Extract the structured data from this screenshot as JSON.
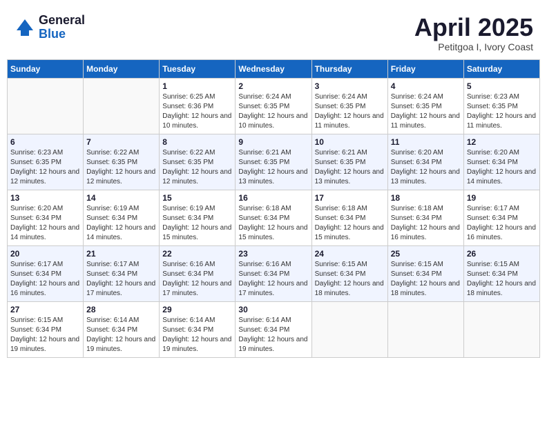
{
  "header": {
    "logo_general": "General",
    "logo_blue": "Blue",
    "month_title": "April 2025",
    "location": "Petitgoa I, Ivory Coast"
  },
  "weekdays": [
    "Sunday",
    "Monday",
    "Tuesday",
    "Wednesday",
    "Thursday",
    "Friday",
    "Saturday"
  ],
  "weeks": [
    [
      {
        "day": "",
        "sunrise": "",
        "sunset": "",
        "daylight": ""
      },
      {
        "day": "",
        "sunrise": "",
        "sunset": "",
        "daylight": ""
      },
      {
        "day": "1",
        "sunrise": "Sunrise: 6:25 AM",
        "sunset": "Sunset: 6:36 PM",
        "daylight": "Daylight: 12 hours and 10 minutes."
      },
      {
        "day": "2",
        "sunrise": "Sunrise: 6:24 AM",
        "sunset": "Sunset: 6:35 PM",
        "daylight": "Daylight: 12 hours and 10 minutes."
      },
      {
        "day": "3",
        "sunrise": "Sunrise: 6:24 AM",
        "sunset": "Sunset: 6:35 PM",
        "daylight": "Daylight: 12 hours and 11 minutes."
      },
      {
        "day": "4",
        "sunrise": "Sunrise: 6:24 AM",
        "sunset": "Sunset: 6:35 PM",
        "daylight": "Daylight: 12 hours and 11 minutes."
      },
      {
        "day": "5",
        "sunrise": "Sunrise: 6:23 AM",
        "sunset": "Sunset: 6:35 PM",
        "daylight": "Daylight: 12 hours and 11 minutes."
      }
    ],
    [
      {
        "day": "6",
        "sunrise": "Sunrise: 6:23 AM",
        "sunset": "Sunset: 6:35 PM",
        "daylight": "Daylight: 12 hours and 12 minutes."
      },
      {
        "day": "7",
        "sunrise": "Sunrise: 6:22 AM",
        "sunset": "Sunset: 6:35 PM",
        "daylight": "Daylight: 12 hours and 12 minutes."
      },
      {
        "day": "8",
        "sunrise": "Sunrise: 6:22 AM",
        "sunset": "Sunset: 6:35 PM",
        "daylight": "Daylight: 12 hours and 12 minutes."
      },
      {
        "day": "9",
        "sunrise": "Sunrise: 6:21 AM",
        "sunset": "Sunset: 6:35 PM",
        "daylight": "Daylight: 12 hours and 13 minutes."
      },
      {
        "day": "10",
        "sunrise": "Sunrise: 6:21 AM",
        "sunset": "Sunset: 6:35 PM",
        "daylight": "Daylight: 12 hours and 13 minutes."
      },
      {
        "day": "11",
        "sunrise": "Sunrise: 6:20 AM",
        "sunset": "Sunset: 6:34 PM",
        "daylight": "Daylight: 12 hours and 13 minutes."
      },
      {
        "day": "12",
        "sunrise": "Sunrise: 6:20 AM",
        "sunset": "Sunset: 6:34 PM",
        "daylight": "Daylight: 12 hours and 14 minutes."
      }
    ],
    [
      {
        "day": "13",
        "sunrise": "Sunrise: 6:20 AM",
        "sunset": "Sunset: 6:34 PM",
        "daylight": "Daylight: 12 hours and 14 minutes."
      },
      {
        "day": "14",
        "sunrise": "Sunrise: 6:19 AM",
        "sunset": "Sunset: 6:34 PM",
        "daylight": "Daylight: 12 hours and 14 minutes."
      },
      {
        "day": "15",
        "sunrise": "Sunrise: 6:19 AM",
        "sunset": "Sunset: 6:34 PM",
        "daylight": "Daylight: 12 hours and 15 minutes."
      },
      {
        "day": "16",
        "sunrise": "Sunrise: 6:18 AM",
        "sunset": "Sunset: 6:34 PM",
        "daylight": "Daylight: 12 hours and 15 minutes."
      },
      {
        "day": "17",
        "sunrise": "Sunrise: 6:18 AM",
        "sunset": "Sunset: 6:34 PM",
        "daylight": "Daylight: 12 hours and 15 minutes."
      },
      {
        "day": "18",
        "sunrise": "Sunrise: 6:18 AM",
        "sunset": "Sunset: 6:34 PM",
        "daylight": "Daylight: 12 hours and 16 minutes."
      },
      {
        "day": "19",
        "sunrise": "Sunrise: 6:17 AM",
        "sunset": "Sunset: 6:34 PM",
        "daylight": "Daylight: 12 hours and 16 minutes."
      }
    ],
    [
      {
        "day": "20",
        "sunrise": "Sunrise: 6:17 AM",
        "sunset": "Sunset: 6:34 PM",
        "daylight": "Daylight: 12 hours and 16 minutes."
      },
      {
        "day": "21",
        "sunrise": "Sunrise: 6:17 AM",
        "sunset": "Sunset: 6:34 PM",
        "daylight": "Daylight: 12 hours and 17 minutes."
      },
      {
        "day": "22",
        "sunrise": "Sunrise: 6:16 AM",
        "sunset": "Sunset: 6:34 PM",
        "daylight": "Daylight: 12 hours and 17 minutes."
      },
      {
        "day": "23",
        "sunrise": "Sunrise: 6:16 AM",
        "sunset": "Sunset: 6:34 PM",
        "daylight": "Daylight: 12 hours and 17 minutes."
      },
      {
        "day": "24",
        "sunrise": "Sunrise: 6:15 AM",
        "sunset": "Sunset: 6:34 PM",
        "daylight": "Daylight: 12 hours and 18 minutes."
      },
      {
        "day": "25",
        "sunrise": "Sunrise: 6:15 AM",
        "sunset": "Sunset: 6:34 PM",
        "daylight": "Daylight: 12 hours and 18 minutes."
      },
      {
        "day": "26",
        "sunrise": "Sunrise: 6:15 AM",
        "sunset": "Sunset: 6:34 PM",
        "daylight": "Daylight: 12 hours and 18 minutes."
      }
    ],
    [
      {
        "day": "27",
        "sunrise": "Sunrise: 6:15 AM",
        "sunset": "Sunset: 6:34 PM",
        "daylight": "Daylight: 12 hours and 19 minutes."
      },
      {
        "day": "28",
        "sunrise": "Sunrise: 6:14 AM",
        "sunset": "Sunset: 6:34 PM",
        "daylight": "Daylight: 12 hours and 19 minutes."
      },
      {
        "day": "29",
        "sunrise": "Sunrise: 6:14 AM",
        "sunset": "Sunset: 6:34 PM",
        "daylight": "Daylight: 12 hours and 19 minutes."
      },
      {
        "day": "30",
        "sunrise": "Sunrise: 6:14 AM",
        "sunset": "Sunset: 6:34 PM",
        "daylight": "Daylight: 12 hours and 19 minutes."
      },
      {
        "day": "",
        "sunrise": "",
        "sunset": "",
        "daylight": ""
      },
      {
        "day": "",
        "sunrise": "",
        "sunset": "",
        "daylight": ""
      },
      {
        "day": "",
        "sunrise": "",
        "sunset": "",
        "daylight": ""
      }
    ]
  ]
}
